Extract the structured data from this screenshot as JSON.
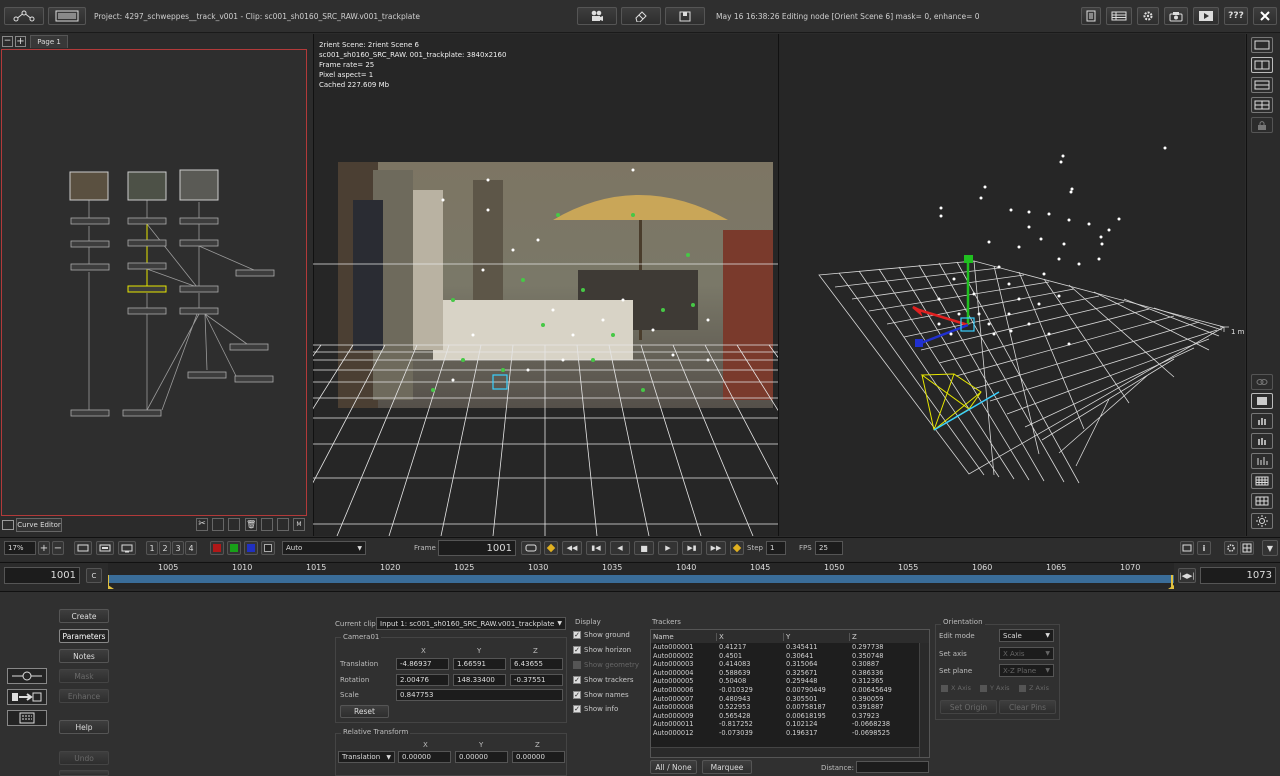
{
  "header": {
    "project_info": "Project: 4297_schweppes__track_v001 - Clip: sc001_sh0160_SRC_RAW.v001_trackplate",
    "status": "May 16 16:38:26 Editing node [Orient Scene 6] mask= 0, enhance= 0",
    "help_label": "???"
  },
  "node_panel": {
    "tab": "Page 1",
    "curve_editor": "Curve Editor"
  },
  "viewer": {
    "info": [
      "2rient Scene:  2rient Scene 6",
      "sc001_sh0160_SRC_RAW.  001_trackplate: 3840x2160",
      "Frame rate= 25",
      "Pixel aspect= 1",
      "Cached 227.609 Mb"
    ],
    "scale_label": "1 m"
  },
  "transport": {
    "zoom": "17%",
    "views": [
      "1",
      "2",
      "3",
      "4"
    ],
    "channel": "Auto",
    "frame_label": "Frame",
    "frame": "1001",
    "step_label": "Step",
    "step": "1",
    "fps_label": "FPS",
    "fps": "25"
  },
  "timeline": {
    "start": "1001",
    "c_label": "C",
    "end": "1073",
    "ticks": [
      "1005",
      "1010",
      "1015",
      "1020",
      "1025",
      "1030",
      "1035",
      "1040",
      "1045",
      "1050",
      "1055",
      "1060",
      "1065",
      "1070"
    ]
  },
  "left_buttons": [
    "Create",
    "Parameters",
    "Notes",
    "Mask",
    "Enhance",
    "Help",
    "Undo"
  ],
  "clip": {
    "label": "Current clip",
    "value": "Input 1: sc001_sh0160_SRC_RAW.v001_trackplate",
    "camera_title": "Camera01",
    "headers": [
      "X",
      "Y",
      "Z"
    ],
    "translation_label": "Translation",
    "translation": [
      "-4.86937",
      "1.66591",
      "6.43655"
    ],
    "rotation_label": "Rotation",
    "rotation": [
      "2.00476",
      "148.33400",
      "-0.37551"
    ],
    "scale_label": "Scale",
    "scale": "0.847753",
    "reset": "Reset",
    "relative_title": "Relative Transform",
    "relative_mode": "Translation",
    "relative": [
      "0.00000",
      "0.00000",
      "0.00000"
    ]
  },
  "display": {
    "title": "Display",
    "items": [
      {
        "label": "Show ground",
        "on": true
      },
      {
        "label": "Show horizon",
        "on": true
      },
      {
        "label": "Show geometry",
        "on": false
      },
      {
        "label": "Show trackers",
        "on": true
      },
      {
        "label": "Show names",
        "on": true
      },
      {
        "label": "Show info",
        "on": true
      }
    ]
  },
  "trackers": {
    "title": "Trackers",
    "headers": [
      "Name",
      "X",
      "Y",
      "Z"
    ],
    "rows": [
      [
        "Auto000001",
        "0.41217",
        "0.345411",
        "0.297738"
      ],
      [
        "Auto000002",
        "0.4501",
        "0.30641",
        "0.350748"
      ],
      [
        "Auto000003",
        "0.414083",
        "0.315064",
        "0.30887"
      ],
      [
        "Auto000004",
        "0.588639",
        "0.325671",
        "0.386336"
      ],
      [
        "Auto000005",
        "0.50408",
        "0.259448",
        "0.312365"
      ],
      [
        "Auto000006",
        "-0.010329",
        "0.00790449",
        "0.00645649"
      ],
      [
        "Auto000007",
        "0.480943",
        "0.305501",
        "0.390059"
      ],
      [
        "Auto000008",
        "0.522953",
        "0.00758187",
        "0.391887"
      ],
      [
        "Auto000009",
        "0.565428",
        "0.00618195",
        "0.37923"
      ],
      [
        "Auto000011",
        "-0.817252",
        "0.102124",
        "-0.0668238"
      ],
      [
        "Auto000012",
        "-0.073039",
        "0.196317",
        "-0.0698525"
      ]
    ],
    "all_none": "All / None",
    "marquee": "Marquee",
    "distance_label": "Distance:"
  },
  "orientation": {
    "title": "Orientation",
    "edit_mode_label": "Edit mode",
    "edit_mode": "Scale",
    "set_axis_label": "Set axis",
    "set_axis": "X Axis",
    "set_plane_label": "Set plane",
    "set_plane": "X-Z Plane",
    "axis_checks": [
      "X Axis",
      "Y Axis",
      "Z Axis"
    ],
    "set_origin": "Set Origin",
    "clear_pins": "Clear Pins"
  }
}
